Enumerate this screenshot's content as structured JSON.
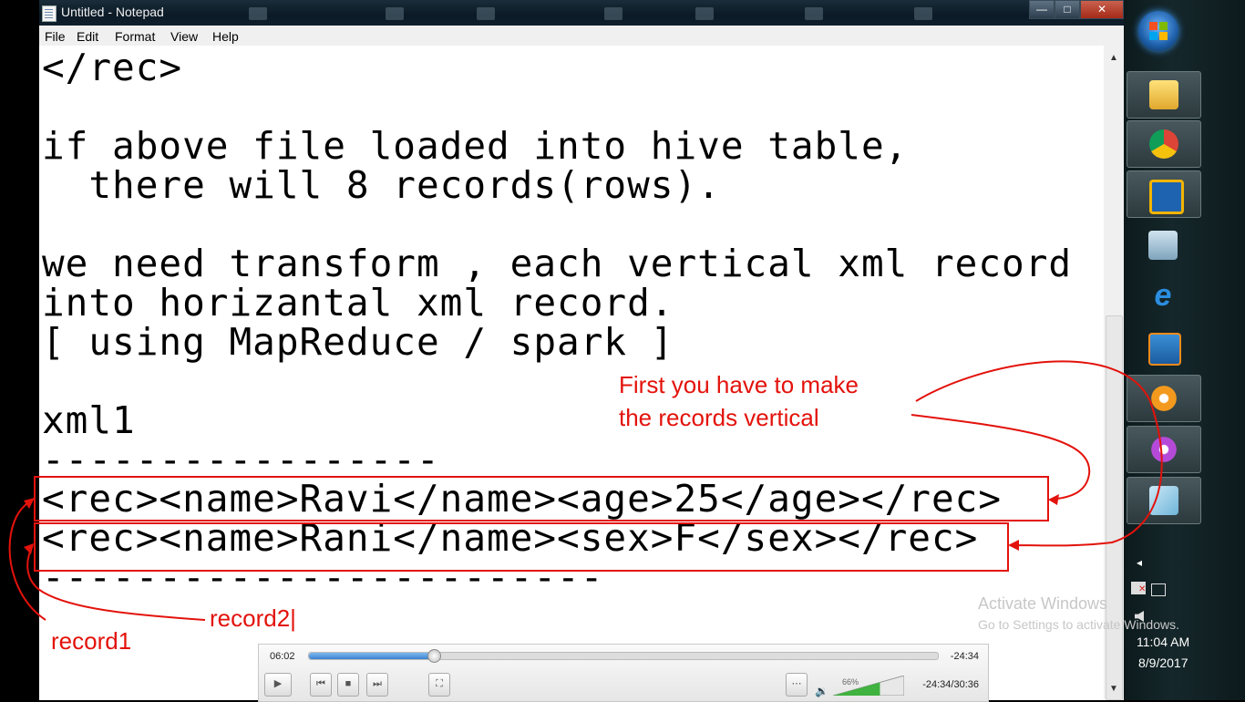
{
  "window": {
    "title": "Untitled - Notepad",
    "controls": {
      "minimize": "—",
      "maximize": "□",
      "close": "✕"
    }
  },
  "menu": [
    "File",
    "Edit",
    "Format",
    "View",
    "Help"
  ],
  "editor_lines": [
    "</rec>",
    "",
    "if above file loaded into hive table,",
    "  there will 8 records(rows).",
    "",
    "we need transform , each vertical xml record",
    "into horizantal xml record.",
    "[ using MapReduce / spark ]",
    "",
    "xml1",
    "-----------------",
    "<rec><name>Ravi</name><age>25</age></rec>",
    "<rec><name>Rani</name><sex>F</sex></rec>",
    "------------------------"
  ],
  "annotations": {
    "note_line1": "First you have to make",
    "note_line2": "the records vertical",
    "record1": "record1",
    "record2": "record2|",
    "color": "#e3120b"
  },
  "watermark": {
    "line1": "Activate Windows",
    "line2": "Go to Settings to activate Windows."
  },
  "taskbar": {
    "apps": [
      "start-orb",
      "file-explorer",
      "chrome",
      "virtualbox",
      "image-viewer",
      "internet-explorer",
      "media-player",
      "flower-app-orange",
      "flower-app-purple",
      "notepad"
    ],
    "clock_time": "11:04 AM",
    "clock_date": "8/9/2017"
  },
  "player": {
    "elapsed": "06:02",
    "remaining": "-24:34",
    "progress": 0.197,
    "volume_label": "66%",
    "volume": 0.66,
    "total": "-24:34/30:36"
  }
}
